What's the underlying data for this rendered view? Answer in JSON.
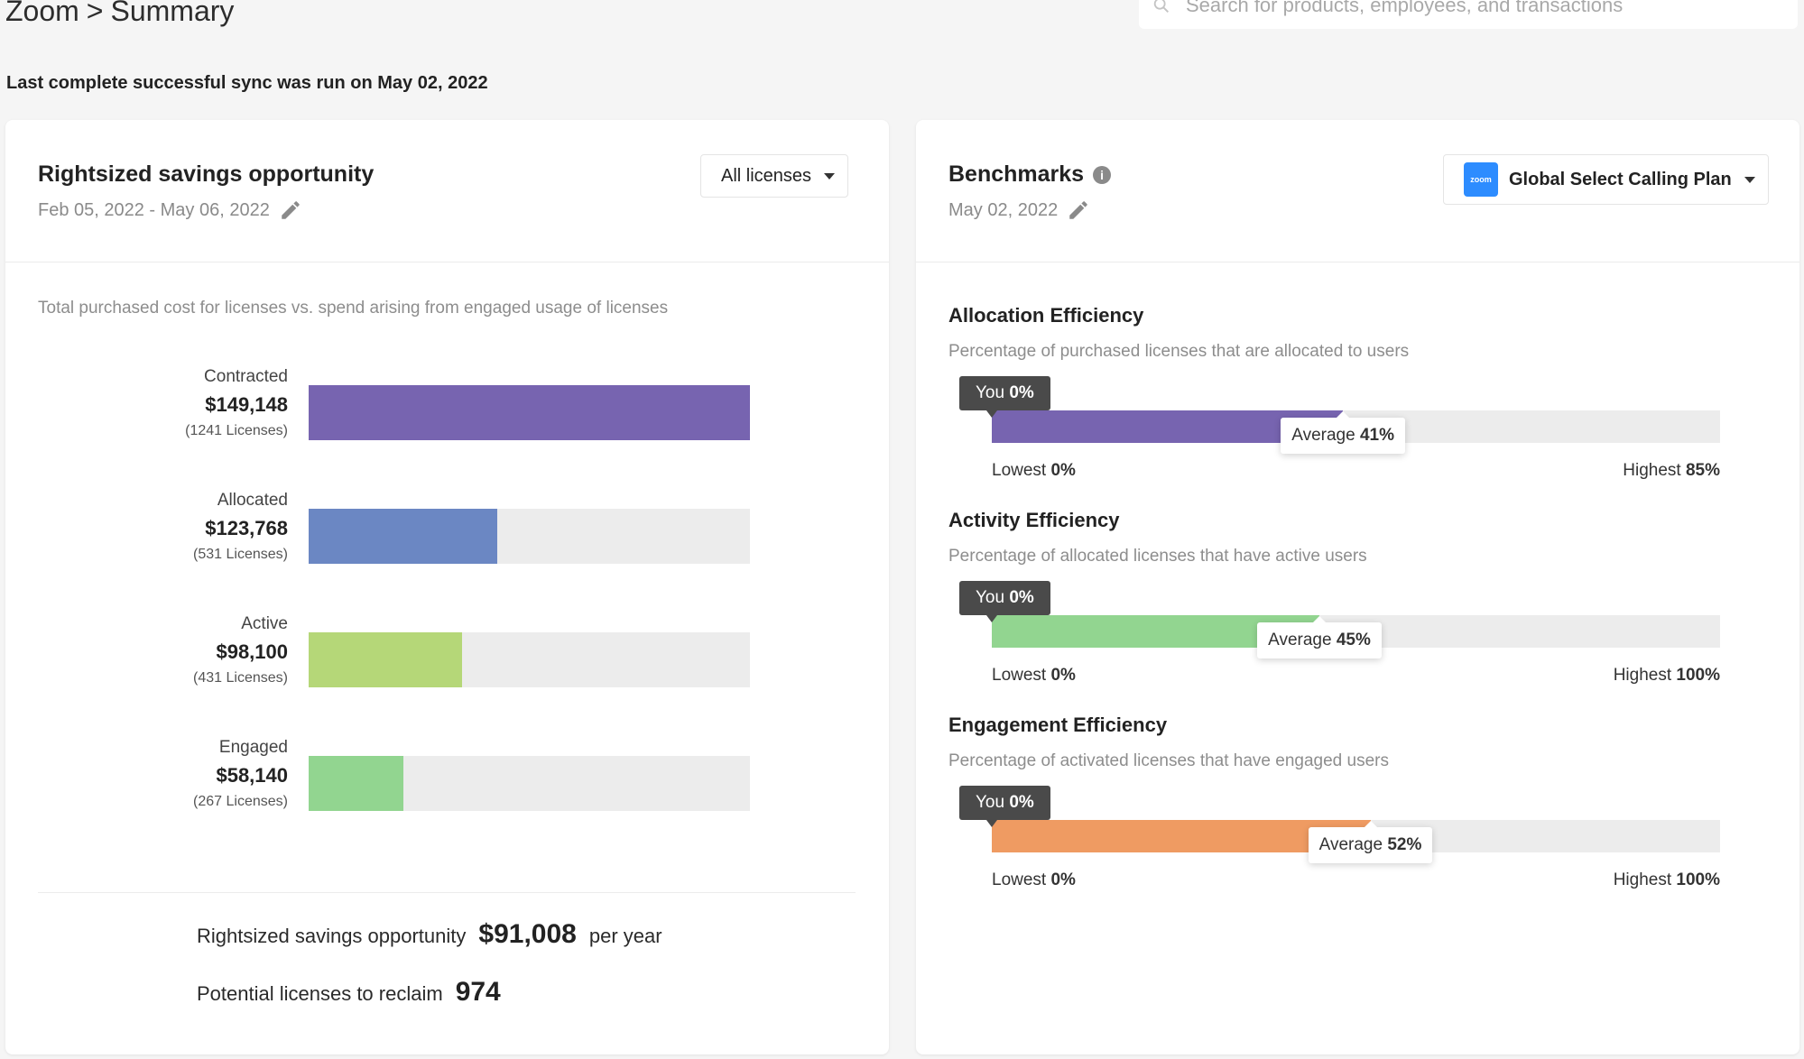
{
  "header": {
    "breadcrumb_app": "Zoom",
    "breadcrumb_sep": ">",
    "breadcrumb_page": "Summary",
    "search_placeholder": "Search for products, employees, and transactions",
    "sync_note": "Last complete successful sync was run on May 02, 2022"
  },
  "savings_card": {
    "title": "Rightsized savings opportunity",
    "date_range": "Feb 05, 2022 - May 06, 2022",
    "filter_label": "All licenses",
    "description": "Total purchased cost for licenses vs. spend arising from engaged usage of licenses",
    "bars": [
      {
        "name": "Contracted",
        "amount": "$149,148",
        "count": "(1241 Licenses)",
        "fraction": 1.0,
        "color": "#7764b0"
      },
      {
        "name": "Allocated",
        "amount": "$123,768",
        "count": "(531 Licenses)",
        "fraction": 0.428,
        "color": "#6b87c3"
      },
      {
        "name": "Active",
        "amount": "$98,100",
        "count": "(431 Licenses)",
        "fraction": 0.347,
        "color": "#b5d778"
      },
      {
        "name": "Engaged",
        "amount": "$58,140",
        "count": "(267 Licenses)",
        "fraction": 0.215,
        "color": "#92d590"
      }
    ],
    "summary": {
      "savings_label": "Rightsized savings opportunity",
      "savings_value": "$91,008",
      "savings_unit": "per year",
      "reclaim_label": "Potential licenses to reclaim",
      "reclaim_value": "974"
    }
  },
  "benchmarks_card": {
    "title": "Benchmarks",
    "info_glyph": "i",
    "date": "May 02, 2022",
    "plan_logo": "zoom",
    "plan_label": "Global Select Calling Plan",
    "lowest_label": "Lowest",
    "highest_label": "Highest",
    "you_label": "You",
    "average_label": "Average",
    "items": [
      {
        "title": "Allocation Efficiency",
        "description": "Percentage of purchased licenses that are allocated to users",
        "you": "0%",
        "average": "41%",
        "average_fraction": 0.41,
        "lowest": "0%",
        "highest": "85%",
        "highest_fraction": 0.85,
        "color": "#7764b0"
      },
      {
        "title": "Activity Efficiency",
        "description": "Percentage of allocated licenses that have active users",
        "you": "0%",
        "average": "45%",
        "average_fraction": 0.45,
        "lowest": "0%",
        "highest": "100%",
        "highest_fraction": 1.0,
        "color": "#92d590"
      },
      {
        "title": "Engagement Efficiency",
        "description": "Percentage of activated licenses that have engaged users",
        "you": "0%",
        "average": "52%",
        "average_fraction": 0.52,
        "lowest": "0%",
        "highest": "100%",
        "highest_fraction": 1.0,
        "color": "#ef9b62"
      }
    ]
  }
}
